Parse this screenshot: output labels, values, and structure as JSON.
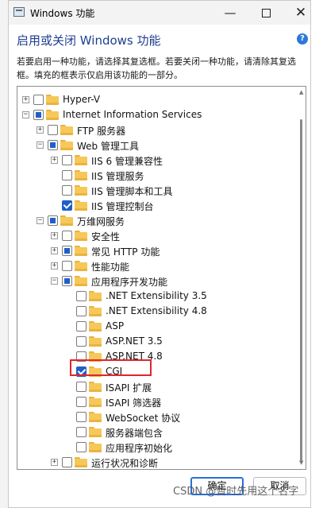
{
  "window": {
    "title": "Windows 功能",
    "minimize_glyph": "—",
    "close_glyph": "✕"
  },
  "heading": "启用或关闭 Windows 功能",
  "help_glyph": "?",
  "description": "若要启用一种功能，请选择其复选框。若要关闭一种功能，请清除其复选框。填充的框表示仅启用该功能的一部分。",
  "tree": [
    {
      "label": "Hyper-V",
      "depth": 0,
      "expander": "+",
      "state": "unchecked"
    },
    {
      "label": "Internet Information Services",
      "depth": 0,
      "expander": "−",
      "state": "partial"
    },
    {
      "label": "FTP 服务器",
      "depth": 1,
      "expander": "+",
      "state": "unchecked"
    },
    {
      "label": "Web 管理工具",
      "depth": 1,
      "expander": "−",
      "state": "partial"
    },
    {
      "label": "IIS 6 管理兼容性",
      "depth": 2,
      "expander": "+",
      "state": "unchecked"
    },
    {
      "label": "IIS 管理服务",
      "depth": 2,
      "expander": "",
      "state": "unchecked"
    },
    {
      "label": "IIS 管理脚本和工具",
      "depth": 2,
      "expander": "",
      "state": "unchecked"
    },
    {
      "label": "IIS 管理控制台",
      "depth": 2,
      "expander": "",
      "state": "checked"
    },
    {
      "label": "万维网服务",
      "depth": 1,
      "expander": "−",
      "state": "partial"
    },
    {
      "label": "安全性",
      "depth": 2,
      "expander": "+",
      "state": "unchecked"
    },
    {
      "label": "常见 HTTP 功能",
      "depth": 2,
      "expander": "+",
      "state": "partial"
    },
    {
      "label": "性能功能",
      "depth": 2,
      "expander": "+",
      "state": "unchecked"
    },
    {
      "label": "应用程序开发功能",
      "depth": 2,
      "expander": "−",
      "state": "partial"
    },
    {
      "label": ".NET Extensibility 3.5",
      "depth": 3,
      "expander": "",
      "state": "unchecked"
    },
    {
      "label": ".NET Extensibility 4.8",
      "depth": 3,
      "expander": "",
      "state": "unchecked"
    },
    {
      "label": "ASP",
      "depth": 3,
      "expander": "",
      "state": "unchecked"
    },
    {
      "label": "ASP.NET 3.5",
      "depth": 3,
      "expander": "",
      "state": "unchecked"
    },
    {
      "label": "ASP.NET 4.8",
      "depth": 3,
      "expander": "",
      "state": "unchecked"
    },
    {
      "label": "CGI",
      "depth": 3,
      "expander": "",
      "state": "checked"
    },
    {
      "label": "ISAPI 扩展",
      "depth": 3,
      "expander": "",
      "state": "unchecked"
    },
    {
      "label": "ISAPI 筛选器",
      "depth": 3,
      "expander": "",
      "state": "unchecked"
    },
    {
      "label": "WebSocket 协议",
      "depth": 3,
      "expander": "",
      "state": "unchecked"
    },
    {
      "label": "服务器端包含",
      "depth": 3,
      "expander": "",
      "state": "unchecked"
    },
    {
      "label": "应用程序初始化",
      "depth": 3,
      "expander": "",
      "state": "unchecked"
    },
    {
      "label": "运行状况和诊断",
      "depth": 2,
      "expander": "+",
      "state": "unchecked"
    }
  ],
  "buttons": {
    "ok": "确定",
    "cancel": "取消"
  },
  "watermark": "CSDN @暂时先用这个名字",
  "colors": {
    "accent": "#1f5fc9",
    "heading": "#1e3d8f",
    "highlight_box": "#e0262d",
    "folder": "#f6c85a"
  }
}
